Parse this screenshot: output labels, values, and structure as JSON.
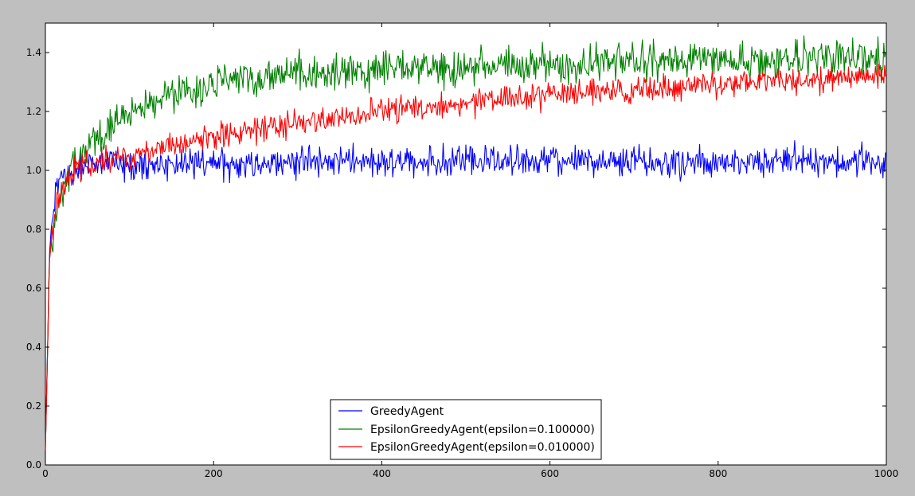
{
  "chart_data": {
    "type": "line",
    "title": "",
    "xlabel": "",
    "ylabel": "",
    "xlim": [
      0,
      1000
    ],
    "ylim": [
      0.0,
      1.5
    ],
    "x_ticks": [
      0,
      200,
      400,
      600,
      800,
      1000
    ],
    "x_tick_labels": [
      "0",
      "200",
      "400",
      "600",
      "800",
      "1000"
    ],
    "y_ticks": [
      0.0,
      0.2,
      0.4,
      0.6,
      0.8,
      1.0,
      1.2,
      1.4
    ],
    "y_tick_labels": [
      "0.0",
      "0.2",
      "0.4",
      "0.6",
      "0.8",
      "1.0",
      "1.2",
      "1.4"
    ],
    "grid": false,
    "legend_position": "bottom-center",
    "background_color": "#bfbfbf",
    "plot_background_color": "#ffffff",
    "series": [
      {
        "name": "GreedyAgent",
        "color": "#0000ff",
        "x": [
          0,
          5,
          10,
          15,
          20,
          30,
          40,
          50,
          75,
          100,
          150,
          200,
          300,
          400,
          500,
          600,
          700,
          800,
          900,
          1000
        ],
        "y": [
          0.05,
          0.72,
          0.88,
          0.95,
          0.98,
          1.0,
          1.01,
          1.02,
          1.02,
          1.02,
          1.02,
          1.02,
          1.03,
          1.03,
          1.03,
          1.03,
          1.03,
          1.03,
          1.03,
          1.03
        ],
        "noise": 0.025
      },
      {
        "name": "EpsilonGreedyAgent(epsilon=0.100000)",
        "color": "#008000",
        "x": [
          0,
          5,
          10,
          15,
          20,
          30,
          50,
          75,
          100,
          150,
          200,
          250,
          300,
          400,
          500,
          600,
          700,
          800,
          900,
          1000
        ],
        "y": [
          0.05,
          0.7,
          0.8,
          0.88,
          0.93,
          1.0,
          1.09,
          1.15,
          1.19,
          1.25,
          1.29,
          1.31,
          1.33,
          1.34,
          1.35,
          1.36,
          1.37,
          1.37,
          1.38,
          1.38
        ],
        "noise": 0.03
      },
      {
        "name": "EpsilonGreedyAgent(epsilon=0.010000)",
        "color": "#ff0000",
        "x": [
          0,
          5,
          10,
          15,
          20,
          30,
          50,
          75,
          100,
          150,
          200,
          300,
          400,
          500,
          600,
          700,
          800,
          900,
          1000
        ],
        "y": [
          0.05,
          0.7,
          0.82,
          0.9,
          0.95,
          0.99,
          1.02,
          1.04,
          1.05,
          1.08,
          1.11,
          1.16,
          1.2,
          1.23,
          1.26,
          1.27,
          1.29,
          1.31,
          1.32
        ],
        "noise": 0.022
      }
    ]
  }
}
